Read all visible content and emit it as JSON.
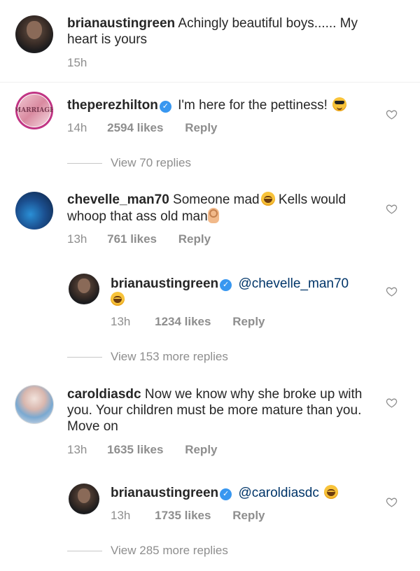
{
  "comments": [
    {
      "username": "brianaustingreen",
      "text": "Achingly beautiful boys...... My heart is yours",
      "time": "15h"
    },
    {
      "username": "theperezhilton",
      "text": "I'm here for the pettiness!",
      "emoji": "sunglasses-emoji",
      "avatar_text": "MARRIAGE",
      "time": "14h",
      "likes": "2594 likes",
      "reply_label": "Reply",
      "view_replies": "View 70 replies"
    },
    {
      "username": "chevelle_man70",
      "text_before": "Someone mad",
      "text_after": "Kells would",
      "text_line2": "whoop that ass old man",
      "time": "13h",
      "likes": "761 likes",
      "reply_label": "Reply",
      "reply": {
        "username": "brianaustingreen",
        "mention": "@chevelle_man70",
        "time": "13h",
        "likes": "1234 likes",
        "reply_label": "Reply"
      },
      "view_replies": "View 153 more replies"
    },
    {
      "username": "caroldiasdc",
      "text": "Now we know why she broke up with you. Your children must be more mature than you. Move on",
      "time": "13h",
      "likes": "1635 likes",
      "reply_label": "Reply",
      "reply": {
        "username": "brianaustingreen",
        "mention": "@caroldiasdc",
        "time": "13h",
        "likes": "1735 likes",
        "reply_label": "Reply"
      },
      "view_replies": "View 285 more replies"
    }
  ],
  "colors": {
    "text": "#262626",
    "meta": "#8e8e8e",
    "mention": "#003569",
    "verified": "#3897f0"
  }
}
